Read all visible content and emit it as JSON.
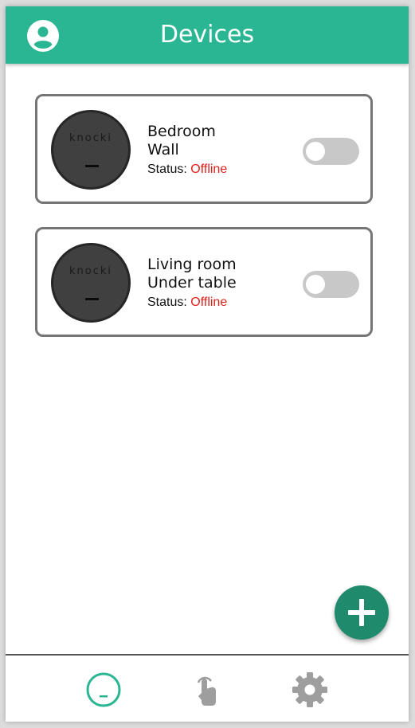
{
  "header": {
    "title": "Devices",
    "profile_icon": "account-circle-icon"
  },
  "devices": [
    {
      "device_icon": "knocki-device-icon",
      "brand": "knocki",
      "room": "Bedroom",
      "location": "Wall",
      "status_label": "Status:",
      "status_value": "Offline",
      "enabled": false
    },
    {
      "device_icon": "knocki-device-icon",
      "brand": "knocki",
      "room": "Living room",
      "location": "Under table",
      "status_label": "Status:",
      "status_value": "Offline",
      "enabled": false
    }
  ],
  "fab": {
    "icon": "plus-icon"
  },
  "bottom_nav": [
    {
      "icon": "knocki-device-icon",
      "active": true
    },
    {
      "icon": "tap-gesture-icon",
      "active": false
    },
    {
      "icon": "gear-icon",
      "active": false
    }
  ],
  "colors": {
    "primary": "#2bb693",
    "fab": "#1f8a6c",
    "status_offline": "#e0201b",
    "toggle_off": "#c8c8c8",
    "inactive_icon": "#9e9e9e"
  }
}
